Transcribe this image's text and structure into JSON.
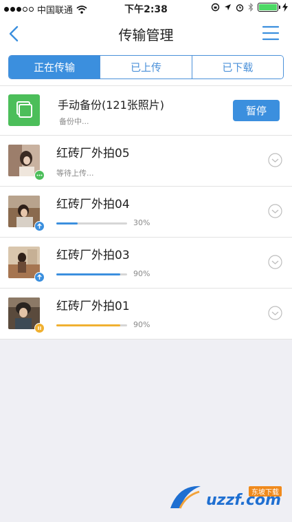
{
  "status_bar": {
    "carrier": "中国联通",
    "time": "下午2:38"
  },
  "navbar": {
    "title": "传输管理",
    "back_icon": "chevron-left-icon",
    "menu_icon": "hamburger-menu-icon"
  },
  "tabs": [
    {
      "label": "正在传输",
      "active": true
    },
    {
      "label": "已上传",
      "active": false
    },
    {
      "label": "已下载",
      "active": false
    }
  ],
  "backup": {
    "title": "手动备份(121张照片)",
    "status": "备份中...",
    "button_label": "暂停",
    "icon": "photo-stack-icon"
  },
  "items": [
    {
      "title": "红砖厂外拍05",
      "status": "等待上传...",
      "badge": "waiting-icon",
      "badge_color": "#4cbe5a",
      "progress": null,
      "progress_label": "",
      "bar_color": ""
    },
    {
      "title": "红砖厂外拍04",
      "status": "",
      "badge": "upload-arrow-icon",
      "badge_color": "#3b8fde",
      "progress": 0.3,
      "progress_label": "30%",
      "bar_color": "#3b8fde"
    },
    {
      "title": "红砖厂外拍03",
      "status": "",
      "badge": "upload-arrow-icon",
      "badge_color": "#3b8fde",
      "progress": 0.9,
      "progress_label": "90%",
      "bar_color": "#3b8fde"
    },
    {
      "title": "红砖厂外拍01",
      "status": "",
      "badge": "paused-icon",
      "badge_color": "#f0b030",
      "progress": 0.9,
      "progress_label": "90%",
      "bar_color": "#f0b030"
    }
  ],
  "watermark": {
    "text": "uzzf.com",
    "tag": "东坡下载"
  },
  "colors": {
    "accent": "#3b8fde",
    "green": "#4cbe5a",
    "paused": "#f0b030"
  }
}
